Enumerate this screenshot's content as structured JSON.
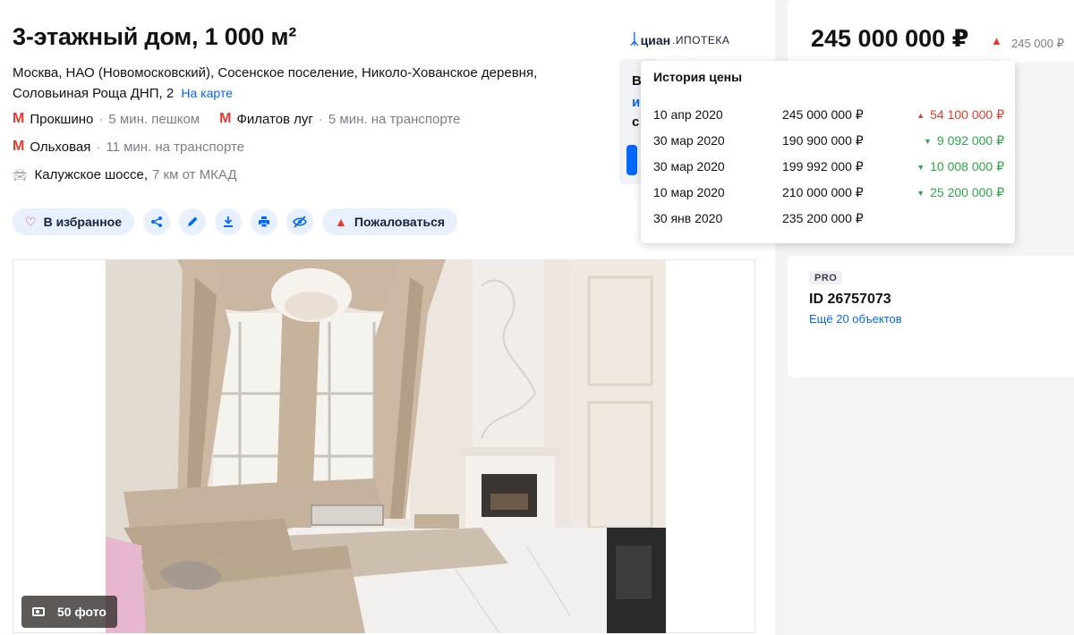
{
  "listing": {
    "title": "3-этажный дом, 1 000 м²",
    "address": "Москва, НАО (Новомосковский), Сосенское поселение, Николо-Хованское деревня, Соловьиная Роща ДНП, 2",
    "map_link": "На карте",
    "metro": [
      {
        "icon": "М",
        "station": "Прокшино",
        "time": "5 мин. пешком"
      },
      {
        "icon": "М",
        "station": "Филатов луг",
        "time": "5 мин. на транспорте"
      },
      {
        "icon": "М",
        "station": "Ольховая",
        "time": "11 мин. на транспорте"
      }
    ],
    "highway": {
      "icon": "car-icon",
      "name": "Калужское шоссе,",
      "distance": "7 км от МКАД"
    }
  },
  "partner": {
    "brand": "циан",
    "product": ".ИПОТЕКА"
  },
  "actions": {
    "favorite": "В избранное",
    "report": "Пожаловаться",
    "icons": [
      "heart-icon",
      "share-icon",
      "edit-icon",
      "download-icon",
      "print-icon",
      "hide-icon",
      "warning-icon"
    ]
  },
  "gallery": {
    "photo_count": "50 фото"
  },
  "hidden_card": {
    "line1": "В",
    "line2": "и",
    "line3": "с"
  },
  "sidebar": {
    "price": "245 000 000 ₽",
    "price_prev": "245 000 ₽",
    "seller": {
      "badge": "PRO",
      "id": "ID 26757073",
      "objects": "Ещё 20 объектов"
    }
  },
  "price_history": {
    "title": "История цены",
    "rows": [
      {
        "date": "10 апр 2020",
        "price": "245 000 000 ₽",
        "change": "54 100 000 ₽",
        "direction": "up"
      },
      {
        "date": "30 мар 2020",
        "price": "190 900 000 ₽",
        "change": "9 092 000 ₽",
        "direction": "down"
      },
      {
        "date": "30 мар 2020",
        "price": "199 992 000 ₽",
        "change": "10 008 000 ₽",
        "direction": "down"
      },
      {
        "date": "10 мар 2020",
        "price": "210 000 000 ₽",
        "change": "25 200 000 ₽",
        "direction": "down"
      },
      {
        "date": "30 янв 2020",
        "price": "235 200 000 ₽",
        "change": "",
        "direction": "none"
      }
    ]
  },
  "colors": {
    "accent": "#0468ff",
    "up": "#e8392b",
    "down": "#2aa944",
    "metro": "#e8392b"
  }
}
